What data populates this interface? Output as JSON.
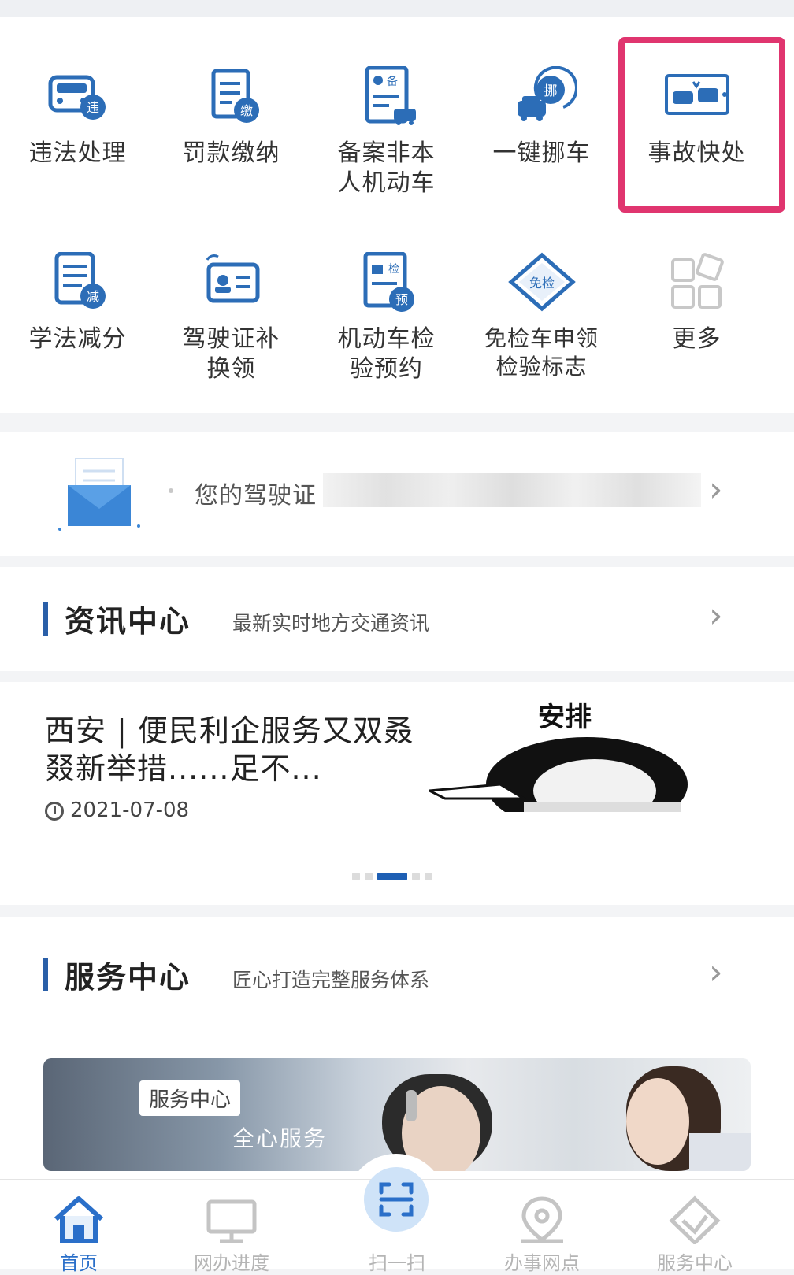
{
  "services": {
    "row1": [
      {
        "label": "违法处理",
        "icon": "car-violation-icon"
      },
      {
        "label": "罚款缴纳",
        "icon": "fine-payment-icon"
      },
      {
        "label": "备案非本\n人机动车",
        "icon": "vehicle-filing-icon"
      },
      {
        "label": "一键挪车",
        "icon": "move-car-icon"
      },
      {
        "label": "事故快处",
        "icon": "accident-icon"
      }
    ],
    "row2": [
      {
        "label": "学法减分",
        "icon": "study-deduct-icon"
      },
      {
        "label": "驾驶证补\n换领",
        "icon": "license-replace-icon"
      },
      {
        "label": "机动车检\n验预约",
        "icon": "inspection-booking-icon"
      },
      {
        "label": "免检车申领\n检验标志",
        "icon": "exempt-sticker-icon"
      },
      {
        "label": "更多",
        "icon": "more-grid-icon"
      }
    ]
  },
  "notice": {
    "text": "您的驾驶证",
    "icon": "envelope-icon"
  },
  "news_section": {
    "title": "资讯中心",
    "subtitle": "最新实时地方交通资讯"
  },
  "news_item": {
    "title": "西安 | 便民利企服务又双叒叕新举措......足不...",
    "date": "2021-07-08",
    "image_caption": "安排"
  },
  "service_section": {
    "title": "服务中心",
    "subtitle": "匠心打造完整服务体系"
  },
  "banner": {
    "tag": "服务中心",
    "text": "全心服务"
  },
  "bottom_nav": [
    {
      "label": "首页",
      "icon": "home-icon",
      "active": true
    },
    {
      "label": "网办进度",
      "icon": "monitor-icon",
      "active": false
    },
    {
      "label": "扫一扫",
      "icon": "scan-icon",
      "active": false
    },
    {
      "label": "办事网点",
      "icon": "location-pin-icon",
      "active": false
    },
    {
      "label": "服务中心",
      "icon": "service-diamond-icon",
      "active": false
    }
  ],
  "colors": {
    "accent": "#2a5fa8",
    "highlight": "#e0356f",
    "icon_blue": "#2c6db7"
  }
}
